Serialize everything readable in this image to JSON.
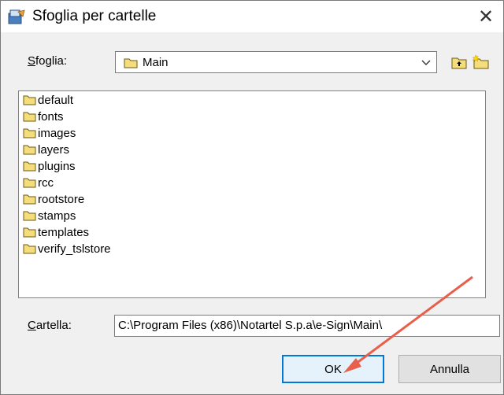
{
  "window": {
    "title": "Sfoglia per cartelle",
    "close_glyph": "✕",
    "app_icon": "folder-browse-icon"
  },
  "browse": {
    "label_prefix": "S",
    "label_rest": "foglia:",
    "selected": "Main"
  },
  "toolbar": {
    "up_icon": "folder-up-icon",
    "new_icon": "new-folder-icon"
  },
  "folders": [
    "default",
    "fonts",
    "images",
    "layers",
    "plugins",
    "rcc",
    "rootstore",
    "stamps",
    "templates",
    "verify_tslstore"
  ],
  "cartella": {
    "label_prefix": "C",
    "label_rest": "artella:",
    "value": "C:\\Program Files (x86)\\Notartel S.p.a\\e-Sign\\Main\\"
  },
  "buttons": {
    "ok": "OK",
    "cancel": "Annulla"
  },
  "colors": {
    "accent": "#0078d7",
    "annotation_arrow": "#e8604c",
    "folder_fill": "#f4dd7a"
  }
}
